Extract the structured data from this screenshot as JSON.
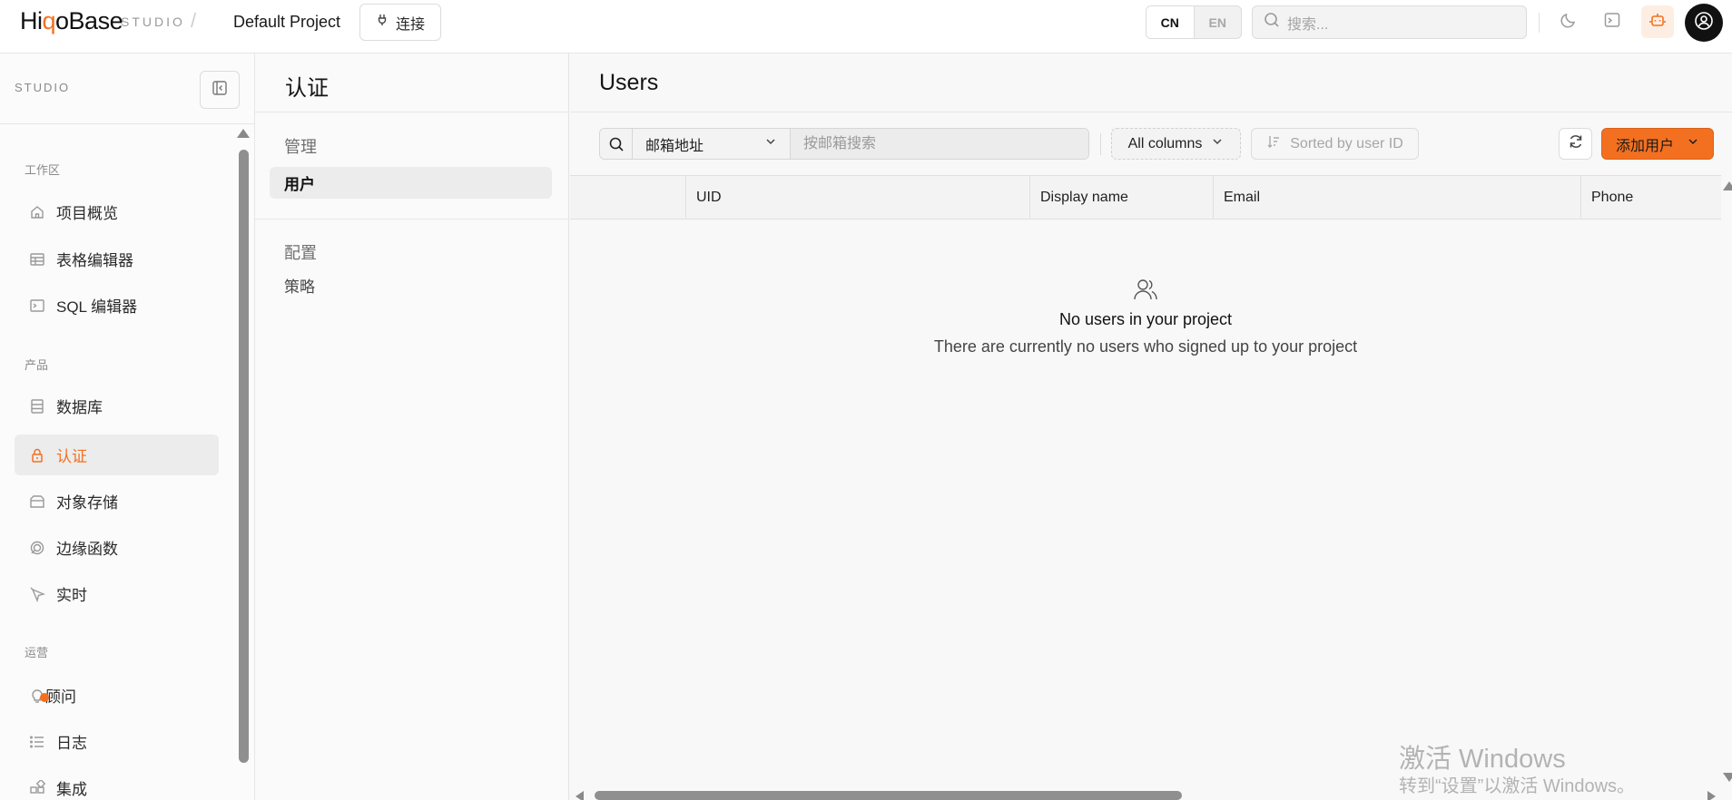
{
  "topbar": {
    "logo_text": "HiqoBase",
    "studio_tag": "STUDIO",
    "separator": "/",
    "project_name": "Default Project",
    "connect_label": "连接",
    "lang": {
      "cn": "CN",
      "en": "EN",
      "active": "CN"
    },
    "search_placeholder": "搜索...",
    "icons": [
      "moon-icon",
      "terminal-icon",
      "assistant-icon",
      "user-avatar-icon"
    ]
  },
  "sidebar": {
    "studio_label": "STUDIO",
    "sections": [
      {
        "title": "工作区",
        "items": [
          {
            "label": "项目概览",
            "icon": "home-icon"
          },
          {
            "label": "表格编辑器",
            "icon": "table-icon"
          },
          {
            "label": "SQL 编辑器",
            "icon": "terminal-icon"
          }
        ]
      },
      {
        "title": "产品",
        "items": [
          {
            "label": "数据库",
            "icon": "database-icon"
          },
          {
            "label": "认证",
            "icon": "lock-icon",
            "active": true
          },
          {
            "label": "对象存储",
            "icon": "storage-icon"
          },
          {
            "label": "边缘函数",
            "icon": "functions-icon"
          },
          {
            "label": "实时",
            "icon": "realtime-icon"
          }
        ]
      },
      {
        "title": "运营",
        "items": [
          {
            "label": "顾问",
            "icon": "lightbulb-icon",
            "badge": true
          },
          {
            "label": "日志",
            "icon": "list-icon"
          },
          {
            "label": "集成",
            "icon": "integrations-icon"
          }
        ]
      }
    ]
  },
  "auth_panel": {
    "title": "认证",
    "groups": [
      {
        "title": "管理",
        "items": [
          {
            "label": "用户",
            "active": true
          }
        ]
      },
      {
        "title": "配置",
        "items": [
          {
            "label": "策略"
          }
        ]
      }
    ]
  },
  "main": {
    "title": "Users",
    "filter": {
      "field_label": "邮箱地址",
      "input_value": "",
      "input_placeholder": "按邮箱搜索"
    },
    "columns_label": "All columns",
    "sort_label": "Sorted by user ID",
    "add_user_label": "添加用户",
    "table_columns": [
      "UID",
      "Display name",
      "Email",
      "Phone"
    ],
    "empty_title": "No users in your project",
    "empty_desc": "There are currently no users who signed up to your project"
  },
  "watermark": {
    "line1": "激活 Windows",
    "line2": "转到“设置”以激活 Windows。"
  },
  "colors": {
    "accent": "#f37021",
    "border": "#e0e0e0"
  }
}
